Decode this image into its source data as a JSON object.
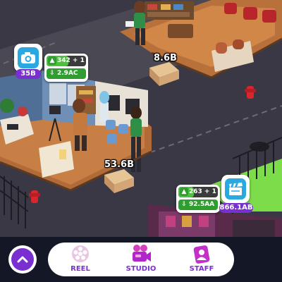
{
  "world": {
    "cash_pickups": [
      {
        "id": "top",
        "amount": "8.6B"
      },
      {
        "id": "middle",
        "amount": "53.6B"
      }
    ]
  },
  "stations": {
    "photo": {
      "icon": "camera-icon",
      "level_badge": "35B",
      "progress_text": "342 + 1",
      "progress_fraction": 0.55,
      "income_text": "2.9AC",
      "accent": "#2aa8e0"
    },
    "film": {
      "icon": "clapperboard-icon",
      "level_badge": "866.1AB",
      "progress_text": "263 + 1",
      "progress_fraction": 0.4,
      "income_text": "92.5AA",
      "accent": "#2aa8e0"
    }
  },
  "bottom_nav": {
    "up_icon": "chevron-up-icon",
    "items": [
      {
        "label": "REEL",
        "icon": "film-reel-icon",
        "active": false
      },
      {
        "label": "STUDIO",
        "icon": "movie-camera-icon",
        "active": true
      },
      {
        "label": "STAFF",
        "icon": "staff-badge-icon",
        "active": false
      }
    ]
  },
  "colors": {
    "brand_purple": "#7a2fd1",
    "income_green": "#2f9d30",
    "station_blue": "#2aa8e0",
    "nav_background": "#141726"
  }
}
